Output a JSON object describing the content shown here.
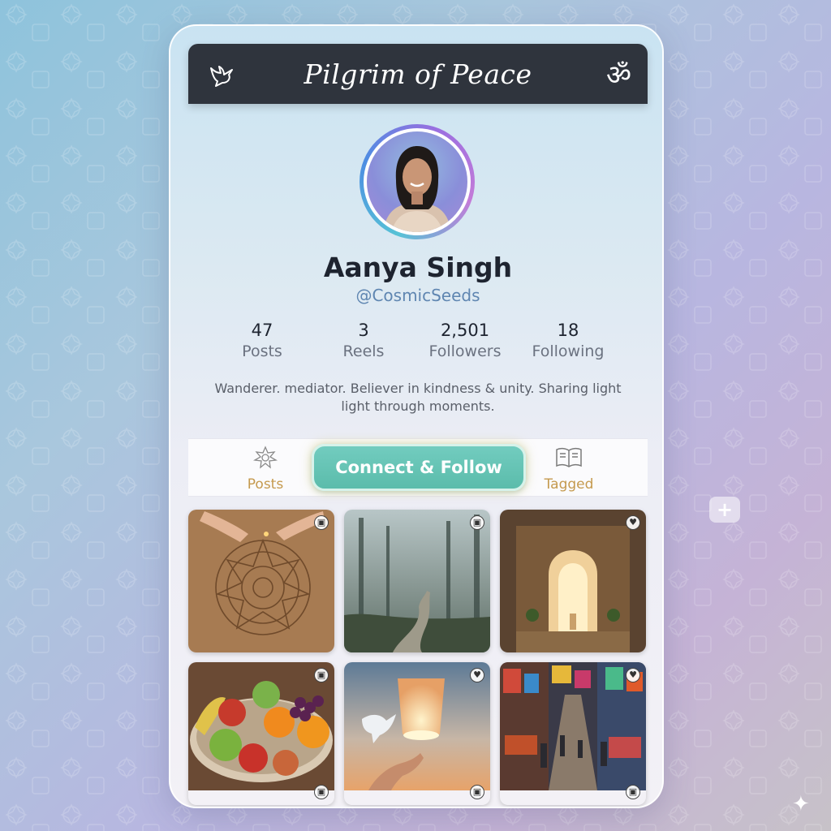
{
  "header": {
    "title": "Pilgrim of Peace",
    "left_icon": "dove-icon",
    "right_icon": "om-icon",
    "right_glyph": "ॐ"
  },
  "profile": {
    "name": "Aanya Singh",
    "handle": "@CosmicSeeds",
    "bio": "Wanderer. mediator. Believer in kindness & unity. Sharing light light through moments."
  },
  "stats": [
    {
      "value": "47",
      "label": "Posts"
    },
    {
      "value": "3",
      "label": "Reels"
    },
    {
      "value": "2,501",
      "label": "Followers"
    },
    {
      "value": "18",
      "label": "Following"
    }
  ],
  "tabs": {
    "posts_label": "Posts",
    "follow_label": "Connect & Follow",
    "tagged_label": "Tagged"
  },
  "grid": [
    {
      "subject": "sand mandala",
      "badge": "multi-icon"
    },
    {
      "subject": "misty forest path",
      "badge": "multi-icon"
    },
    {
      "subject": "temple hall",
      "badge": "heart-icon"
    },
    {
      "subject": "fruit platter",
      "badge": "multi-icon"
    },
    {
      "subject": "sky lantern and dove",
      "badge": "heart-icon"
    },
    {
      "subject": "market street",
      "badge": "heart-icon"
    }
  ],
  "colors": {
    "header_bg": "#2f343d",
    "accent_teal": "#5bbcab",
    "tab_gold": "#c59a4e",
    "handle_blue": "#5f86b1"
  }
}
